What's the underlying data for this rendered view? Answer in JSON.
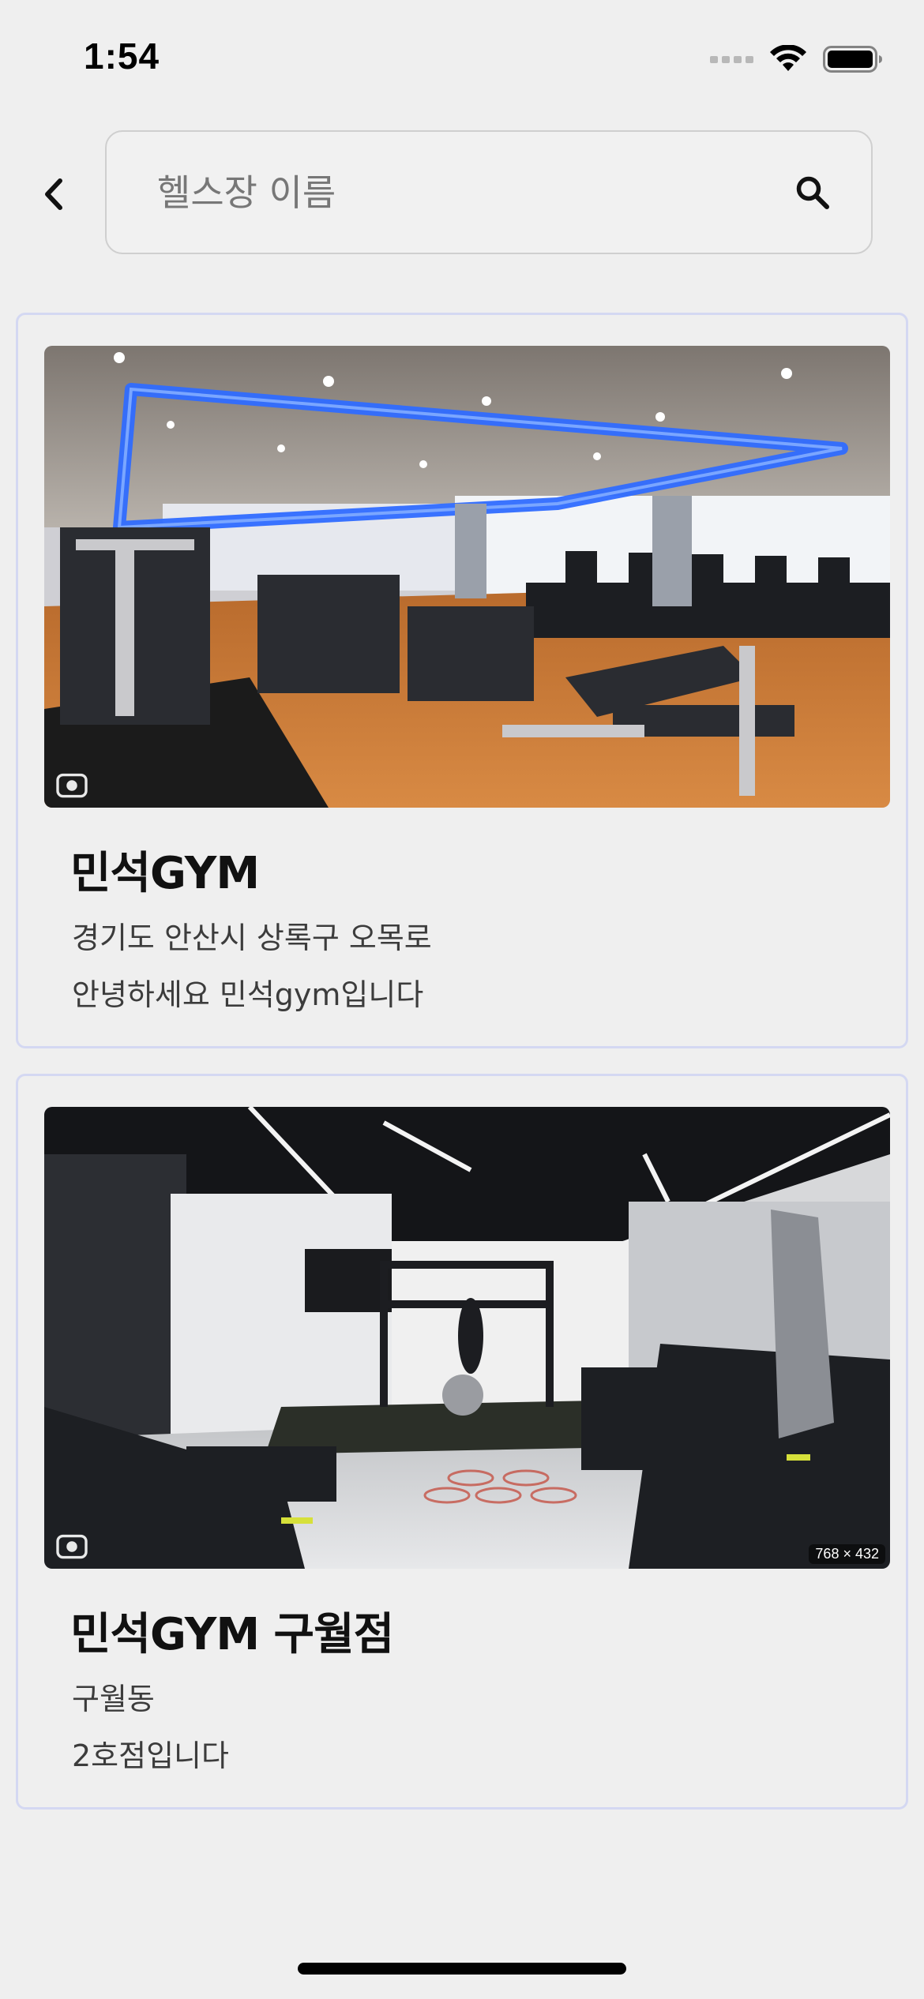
{
  "status_bar": {
    "time": "1:54"
  },
  "search": {
    "placeholder": "헬스장 이름",
    "value": ""
  },
  "gyms": [
    {
      "name": "민석GYM",
      "address": "경기도 안산시 상록구 오목로",
      "description": "안녕하세요 민석gym입니다",
      "image_badge": ""
    },
    {
      "name": "민석GYM 구월점",
      "address": "구월동",
      "description": "2호점입니다",
      "image_badge": "768 × 432"
    }
  ],
  "icons": [
    "back-chevron-icon",
    "search-icon",
    "wifi-icon",
    "battery-icon",
    "cellular-signal-icon",
    "image-search-lens-icon"
  ],
  "colors": {
    "background": "#efefef",
    "card_border": "#d4d8f2",
    "gym1_ceiling_light": "#2f6bff"
  }
}
